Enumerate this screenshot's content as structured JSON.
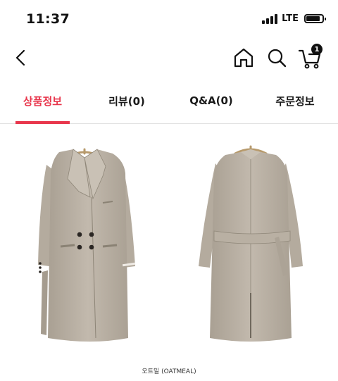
{
  "status_bar": {
    "time": "11:37",
    "network": "LTE",
    "battery_level": 0.85
  },
  "nav": {
    "back_icon": "chevron-left-icon",
    "home_icon": "home-icon",
    "search_icon": "search-icon",
    "cart_icon": "cart-icon",
    "cart_count": "1"
  },
  "tabs": [
    {
      "label": "상품정보",
      "active": true
    },
    {
      "label": "리뷰(0)",
      "active": false
    },
    {
      "label": "Q&A(0)",
      "active": false
    },
    {
      "label": "주문정보",
      "active": false
    }
  ],
  "product": {
    "color_caption": "오트밀 (OATMEAL)"
  },
  "colors": {
    "accent": "#e8364c",
    "coat": "#bdb3a6"
  }
}
